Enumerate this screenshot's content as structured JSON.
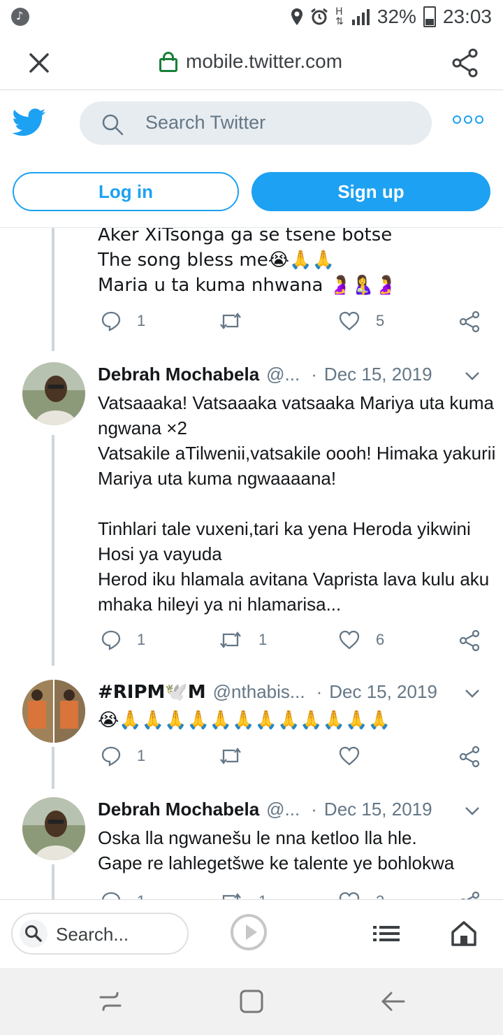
{
  "status_bar": {
    "battery": "32%",
    "time": "23:03",
    "icons": [
      "music-note-icon",
      "location-icon",
      "alarm-icon",
      "network-h-icon",
      "signal-icon",
      "battery-icon"
    ]
  },
  "browser": {
    "url": "mobile.twitter.com",
    "icons": [
      "close-icon",
      "lock-icon",
      "share-icon"
    ]
  },
  "twitter_header": {
    "search_placeholder": "Search Twitter",
    "login_label": "Log in",
    "signup_label": "Sign up",
    "accent": "#1da1f2"
  },
  "tweets": [
    {
      "text": "Aker XiTsonga ga se tsene botse\nThe song bless me😭🙏🙏\nMaria u ta kuma nhwana 🤰🤱🤰",
      "replies": "1",
      "retweets": "",
      "likes": "5"
    },
    {
      "name": "Debrah Mochabela",
      "handle": "@...",
      "date": "Dec 15, 2019",
      "text": "Vatsaaaka! Vatsaaaka vatsaaka Mariya uta kuma ngwana ×2\nVatsakile aTilwenii,vatsakile oooh! Himaka yakurii Mariya uta kuma ngwaaaana!\n\nTinhlari tale vuxeni,tari ka yena Heroda yikwini Hosi ya vayuda\nHerod iku hlamala avitana Vaprista lava kulu aku mhaka hileyi ya ni hlamarisa...",
      "replies": "1",
      "retweets": "1",
      "likes": "6"
    },
    {
      "name": "#RIPM🕊️M",
      "handle": "@nthabis...",
      "date": "Dec 15, 2019",
      "text": "😭🙏🙏🙏🙏🙏🙏🙏🙏🙏🙏🙏🙏",
      "replies": "1",
      "retweets": "",
      "likes": ""
    },
    {
      "name": "Debrah Mochabela",
      "handle": "@...",
      "date": "Dec 15, 2019",
      "text": "Oska lla ngwanešu le nna ketloo lla hle.\nGape re lahlegetšwe ke talente ye bohlokwa",
      "replies": "1",
      "retweets": "1",
      "likes": "2"
    }
  ],
  "bottom_toolbar": {
    "search_placeholder": "Search..."
  }
}
